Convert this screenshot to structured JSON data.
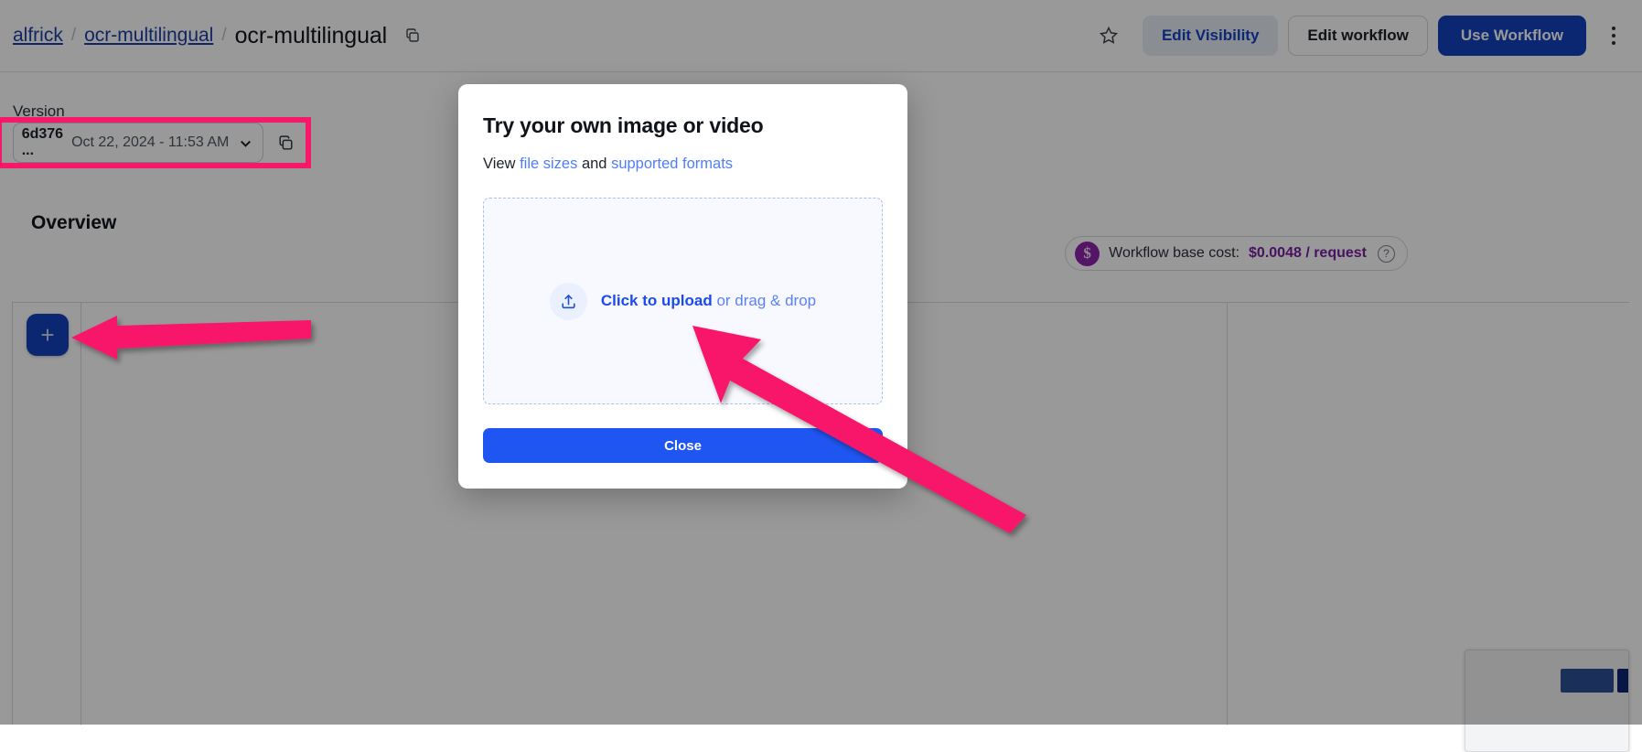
{
  "header": {
    "breadcrumb": [
      {
        "label": "alfrick",
        "type": "link"
      },
      {
        "label": "ocr-multilingual",
        "type": "link"
      },
      {
        "label": "ocr-multilingual",
        "type": "current"
      }
    ],
    "separator": "/",
    "copy_icon": "copy-icon",
    "star_icon": "star-outline-icon",
    "kebab_icon": "more-vertical-icon",
    "buttons": [
      {
        "label": "Edit Visibility",
        "style": "ghost-active"
      },
      {
        "label": "Edit workflow",
        "style": "outline"
      },
      {
        "label": "Use Workflow",
        "style": "primary"
      }
    ]
  },
  "version": {
    "label": "Version",
    "hash": "6d376 ...",
    "date": "Oct 22, 2024 - 11:53 AM",
    "chevron_icon": "chevron-down-icon",
    "copy_icon": "copy-icon"
  },
  "overview": {
    "title": "Overview",
    "cost": {
      "coin_glyph": "$",
      "label": "Workflow base cost:",
      "value": "$0.0048 / request",
      "help_icon": "question-circle-icon",
      "coin_color": "#8e24aa",
      "value_color": "#7b1fa2"
    },
    "add_node_label": "+",
    "add_node_color": "#1341bd"
  },
  "modal": {
    "title": "Try your own image or video",
    "subtitle_prefix": "View",
    "subtitle_link_1": "file sizes",
    "subtitle_mid": "and",
    "subtitle_link_2": "supported formats",
    "dropzone": {
      "upload_icon": "upload-icon",
      "strong_text": "Click to upload",
      "weak_text": "or drag & drop"
    },
    "close_label": "Close",
    "close_color": "#1f56f2"
  },
  "annotations": {
    "highlight_color": "#f8186a",
    "box_target": "version-selector",
    "arrow_1_target": "add-node-button",
    "arrow_2_target": "click-to-upload"
  }
}
